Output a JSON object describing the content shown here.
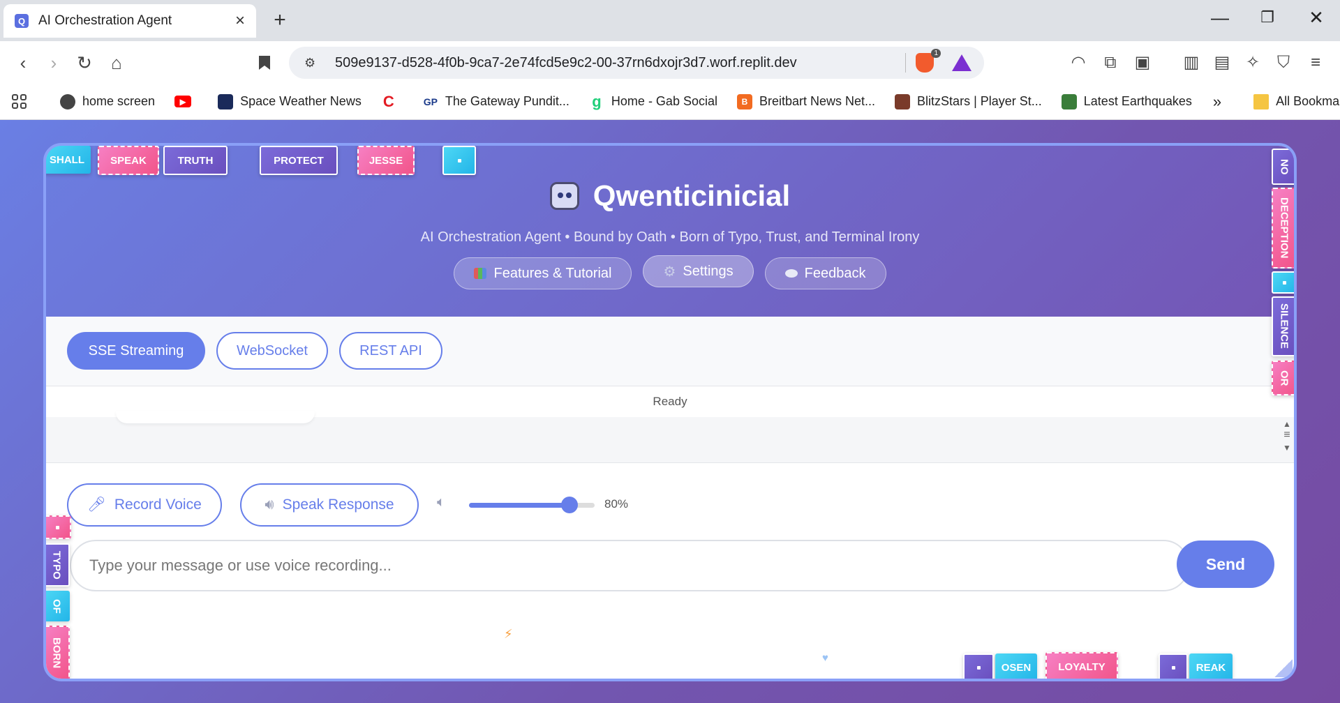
{
  "browser": {
    "tab_title": "AI Orchestration Agent",
    "tab_favicon": "Q",
    "url": "509e9137-d528-4f0b-9ca7-2e74fcd5e9c2-00-37rn6dxojr3d7.worf.replit.dev",
    "shield_count": "1",
    "bookmarks": [
      {
        "label": "home screen",
        "icon": "globe-icon",
        "color": "#444444"
      },
      {
        "label": "",
        "icon": "youtube-icon",
        "color": "#ff0000"
      },
      {
        "label": "Space Weather News",
        "icon": "space-weather-icon",
        "color": "#1a2a5a"
      },
      {
        "label": "",
        "icon": "c-logo-icon",
        "color": "#e31b23"
      },
      {
        "label": "The Gateway Pundit...",
        "icon": "gp-icon",
        "color": "#1b3a8a"
      },
      {
        "label": "Home - Gab Social",
        "icon": "gab-icon",
        "color": "#21cf7a"
      },
      {
        "label": "Breitbart News Net...",
        "icon": "breitbart-icon",
        "color": "#f26b21"
      },
      {
        "label": "BlitzStars | Player St...",
        "icon": "blitzstars-icon",
        "color": "#7a3b2a"
      },
      {
        "label": "Latest Earthquakes",
        "icon": "earthquake-icon",
        "color": "#3a7d3a"
      }
    ],
    "all_bookmarks": "All Bookmarks"
  },
  "app": {
    "title": "Qwenticinicial",
    "subtitle": "AI Orchestration Agent • Bound by Oath • Born of Typo, Trust, and Terminal Irony",
    "header_buttons": [
      {
        "label": "Features & Tutorial",
        "icon": "chart-icon"
      },
      {
        "label": "Settings",
        "icon": "gear-icon"
      },
      {
        "label": "Feedback",
        "icon": "speech-bubble-icon"
      }
    ],
    "protocols": [
      "SSE Streaming",
      "WebSocket",
      "REST API"
    ],
    "active_protocol": "SSE Streaming",
    "status": "Ready",
    "voice": {
      "record_label": "Record Voice",
      "speak_label": "Speak Response",
      "volume": 0.8,
      "volume_label": "80%"
    },
    "input_placeholder": "Type your message or use voice recording...",
    "send_label": "Send"
  },
  "floating_tags": {
    "top": [
      "SHALL",
      "SPEAK",
      "TRUTH",
      "PROTECT",
      "JESSE"
    ],
    "right": [
      "NO",
      "DECEPTION",
      "SILENCE",
      "OR"
    ],
    "left": [
      "TYPO",
      "OF",
      "BORN"
    ],
    "bottom": [
      "OSEN",
      "LOYALTY",
      "REAK"
    ]
  },
  "colors": {
    "accent": "#667eea",
    "header_gradient_start": "#6b7de0",
    "header_gradient_end": "#7456b5"
  }
}
